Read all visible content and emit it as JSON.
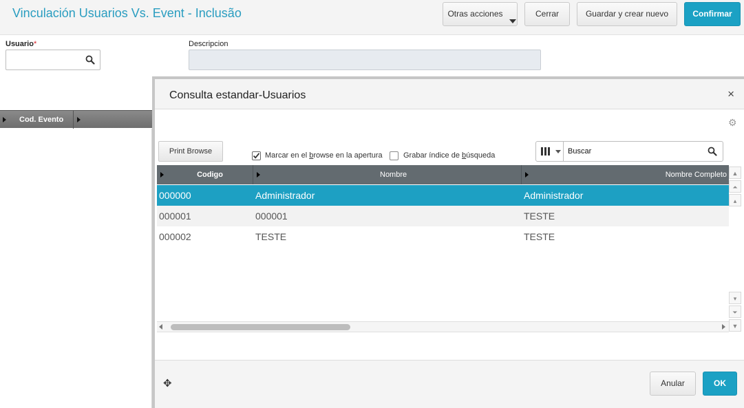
{
  "header": {
    "title": "Vinculación Usuarios Vs. Event - Inclusão",
    "buttons": {
      "other_actions": "Otras acciones",
      "close": "Cerrar",
      "save_new": "Guardar y crear nuevo",
      "confirm": "Confirmar"
    }
  },
  "form": {
    "usuario_label": "Usuario",
    "required_mark": "*",
    "usuario_value": "",
    "descripcion_label": "Descripcion",
    "descripcion_value": ""
  },
  "left_grid": {
    "column": "Cod. Evento"
  },
  "dialog": {
    "title": "Consulta estandar-Usuarios",
    "close_glyph": "×",
    "print_browse": "Print Browse",
    "checkbox_mark_prefix": "Marcar en el ",
    "checkbox_mark_u": "b",
    "checkbox_mark_suffix": "rowse en la apertura",
    "checkbox_mark_checked": true,
    "checkbox_index_prefix": "Grabar índice de ",
    "checkbox_index_u": "b",
    "checkbox_index_suffix": "úsqueda",
    "checkbox_index_checked": false,
    "search_value": "Buscar",
    "columns": [
      "Codigo",
      "Nombre",
      "Nombre Completo"
    ],
    "rows": [
      {
        "codigo": "000000",
        "nombre": "Administrador",
        "nombre_completo": "Administrador",
        "selected": true
      },
      {
        "codigo": "000001",
        "nombre": "000001",
        "nombre_completo": "TESTE",
        "selected": false
      },
      {
        "codigo": "000002",
        "nombre": "TESTE",
        "nombre_completo": "TESTE",
        "selected": false
      }
    ],
    "footer": {
      "cancel": "Anular",
      "ok": "OK"
    }
  },
  "colors": {
    "accent": "#1ba1c4",
    "title": "#2a9dc0",
    "selected_row": "#1da0c3",
    "grid_header": "#636b70"
  }
}
